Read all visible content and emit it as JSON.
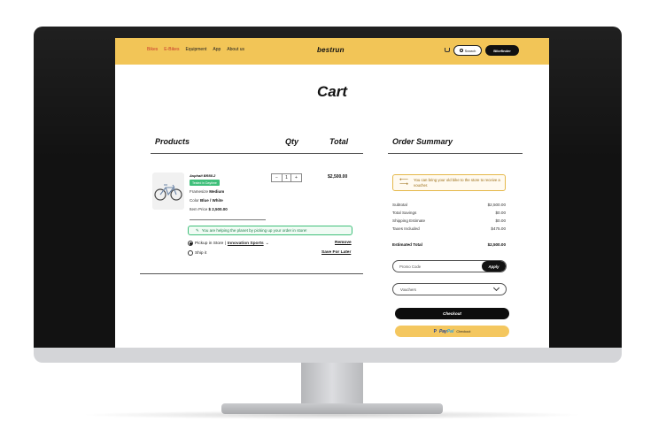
{
  "header": {
    "nav": [
      "Bikes",
      "E-Bikes",
      "Equipment",
      "App",
      "About us"
    ],
    "brand": "bestrun",
    "search_label": "Search",
    "store_label": "Bikefinder"
  },
  "page_title": "Cart",
  "columns": {
    "products": "Products",
    "qty": "Qty",
    "total": "Total",
    "summary": "Order Summary"
  },
  "item": {
    "name": "Asphalt BR88.2",
    "tag": "Tested in Daytime",
    "frame_label": "Framesize",
    "frame_value": "Medium",
    "color_label": "Color",
    "color_value": "Blue / White",
    "price_label": "Item Price",
    "price_value": "$ 2,500.00",
    "qty_minus": "−",
    "qty_value": "1",
    "qty_plus": "+",
    "total": "$2,500.00",
    "green_note": "You are helping the planet by picking up your order in store!",
    "pickup_label": "Pickup in Store |",
    "pickup_store": "Innovation Sports",
    "ship_label": "Ship it",
    "remove": "Remove",
    "save_later": "Save For Later"
  },
  "summary": {
    "notice": "You can bring your old bike to the store to receive a voucher.",
    "rows": [
      {
        "label": "Subtotal",
        "value": "$2,500.00"
      },
      {
        "label": "Total Savings",
        "value": "$0.00"
      },
      {
        "label": "Shipping Estimate",
        "value": "$0.00"
      },
      {
        "label": "Taxes Included",
        "value": "$475.00"
      }
    ],
    "estimated_label": "Estimated Total",
    "estimated_value": "$2,500.00",
    "promo_placeholder": "Promo Code",
    "apply": "Apply",
    "vouchers": "Vouchers",
    "checkout": "Checkout",
    "paypal_a": "Pay",
    "paypal_b": "Pal",
    "paypal_c": "Checkout"
  }
}
